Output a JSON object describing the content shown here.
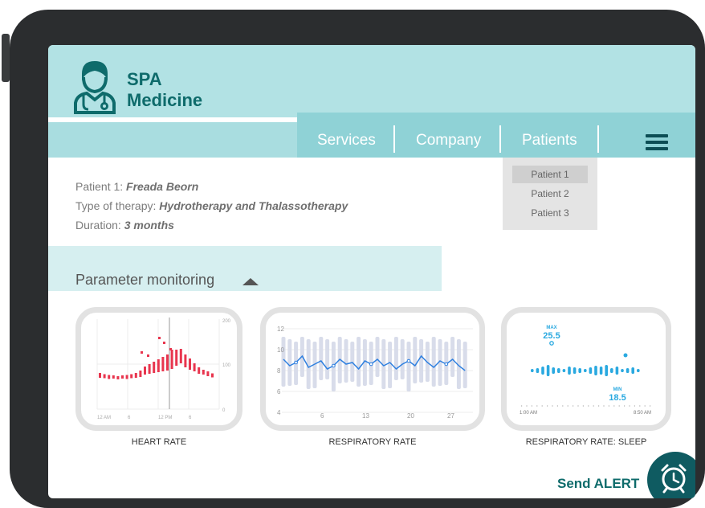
{
  "brand": {
    "line1": "SPA",
    "line2": "Medicine"
  },
  "nav": {
    "items": [
      "Services",
      "Company",
      "Patients"
    ]
  },
  "dropdown": {
    "items": [
      "Patient 1",
      "Patient 2",
      "Patient 3"
    ]
  },
  "patient": {
    "name_label": "Patient 1: ",
    "name_value": "Freada Beorn",
    "therapy_label": "Type of therapy: ",
    "therapy_value": "Hydrotherapy and Thalassotherapy",
    "duration_label": "Duration: ",
    "duration_value": "3 months"
  },
  "section": {
    "title": "Parameter monitoring"
  },
  "cards": {
    "heart": {
      "label": "HEART RATE",
      "y_ticks": [
        "200",
        "100",
        "0"
      ],
      "x_ticks": [
        "12 AM",
        "6",
        "12 PM",
        "6"
      ]
    },
    "resp": {
      "label": "RESPIRATORY RATE",
      "y_ticks": [
        "12",
        "10",
        "8",
        "6",
        "4"
      ],
      "x_ticks": [
        "6",
        "13",
        "20",
        "27"
      ]
    },
    "sleep": {
      "label": "RESPIRATORY RATE: SLEEP",
      "max_label": "MAX",
      "max_value": "25.5",
      "min_label": "MIN",
      "min_value": "18.5",
      "time_start": "1:00 AM",
      "time_end": "8:50 AM"
    }
  },
  "alert": {
    "label": "Send ALERT"
  },
  "colors": {
    "teal_dark": "#0e6b6b",
    "nav": "#8fd2d6",
    "heart": "#e8354e",
    "resp_line": "#2f80e0",
    "sleep": "#2aa9e0"
  }
}
